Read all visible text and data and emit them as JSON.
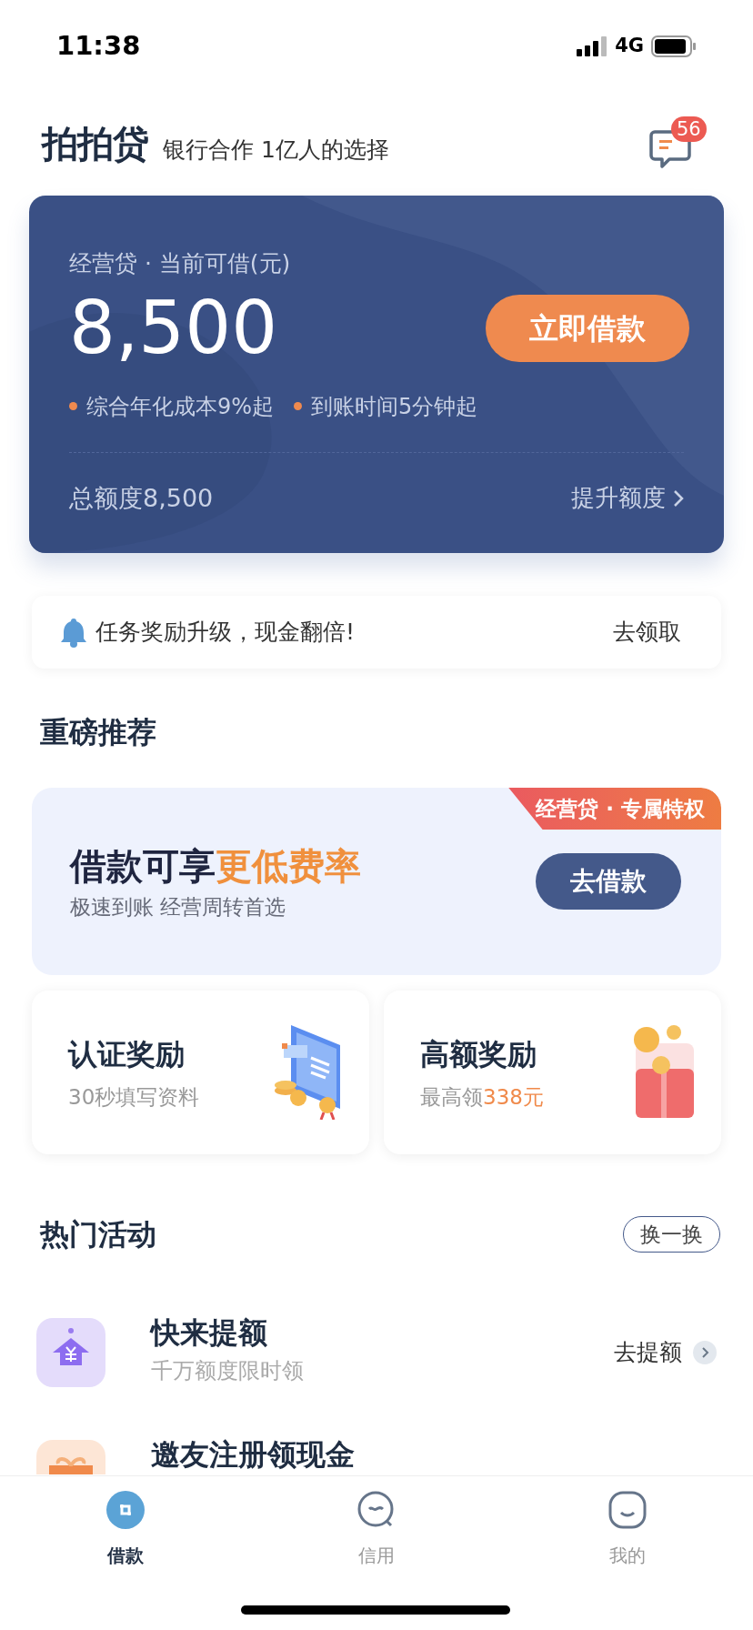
{
  "status_bar": {
    "time": "11:38",
    "network": "4G"
  },
  "header": {
    "logo": "拍拍贷",
    "tagline": "银行合作 1亿人的选择",
    "message_count": "56"
  },
  "loan_card": {
    "label": "经营贷 · 当前可借(元)",
    "amount": "8,500",
    "button": "立即借款",
    "features": [
      "综合年化成本9%起",
      "到账时间5分钟起"
    ],
    "total": "总额度8,500",
    "raise": "提升额度"
  },
  "notice": {
    "text": "任务奖励升级，现金翻倍!",
    "action": "去领取"
  },
  "featured": {
    "title": "重磅推荐",
    "banner": {
      "tag": "经营贷 · 专属特权",
      "headline": "借款可享**更低费率**",
      "subtitle": "极速到账 经营周转首选",
      "button": "去借款"
    },
    "cards": [
      {
        "kind": "certificate",
        "title": "认证奖励",
        "subtitle": "30秒填写资料"
      },
      {
        "kind": "redpacket",
        "title": "高额奖励",
        "subtitle": "最高领**338元**"
      }
    ]
  },
  "activities": {
    "title": "热门活动",
    "refresh": "换一换",
    "items": [
      {
        "kind": "house",
        "title": "快来提额",
        "subtitle": "千万额度限时领",
        "action": "去提额"
      },
      {
        "kind": "gift",
        "title": "邀友注册领现金"
      }
    ]
  },
  "tab_bar": [
    {
      "label": "借款",
      "selected": true,
      "kind": "loan"
    },
    {
      "label": "信用",
      "selected": false,
      "kind": "credit"
    },
    {
      "label": "我的",
      "selected": false,
      "kind": "me"
    }
  ]
}
